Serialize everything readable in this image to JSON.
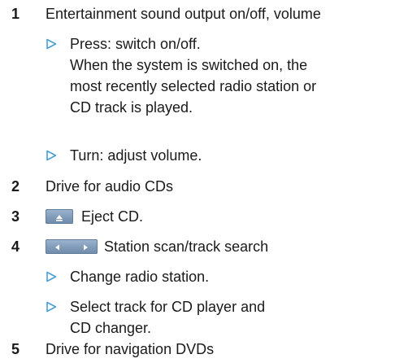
{
  "colors": {
    "accent_marker": "#4a9fd8",
    "button_blue": "#7f9bb9",
    "text": "#1a1a1a"
  },
  "items": [
    {
      "number": "1",
      "label": "Entertainment sound output on/off, volume",
      "subitems": [
        "Press: switch on/off.\nWhen the system is switched on, the\nmost recently selected radio station or\nCD track is played.",
        "Turn: adjust volume."
      ]
    },
    {
      "number": "2",
      "label": "Drive for audio CDs"
    },
    {
      "number": "3",
      "icon": "eject-button-icon",
      "label": "Eject CD."
    },
    {
      "number": "4",
      "icon": "seek-buttons-icon",
      "label": "Station scan/track search",
      "subitems": [
        "Change radio station.",
        "Select track for CD player and\nCD changer."
      ]
    },
    {
      "number": "5",
      "label": "Drive for navigation DVDs"
    }
  ]
}
